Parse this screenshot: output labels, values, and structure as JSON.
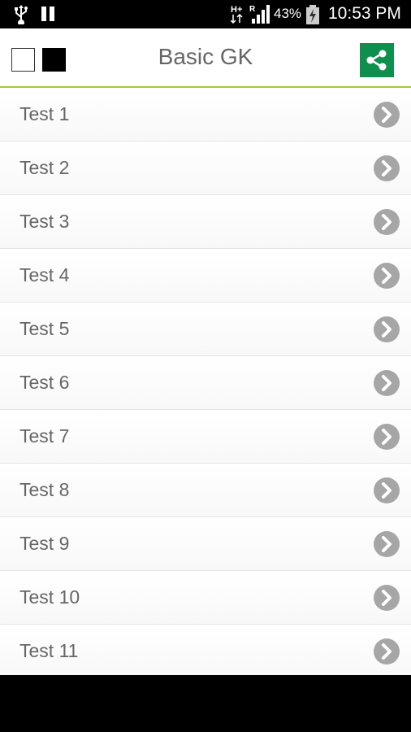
{
  "status_bar": {
    "network_label": "H+",
    "roaming_label": "R",
    "battery_percent": "43%",
    "time": "10:53 PM"
  },
  "app_bar": {
    "title": "Basic GK",
    "share_icon": "share-icon",
    "accent_color": "#0f8f4e",
    "divider_color": "#a4c639"
  },
  "tests": [
    {
      "label": "Test 1"
    },
    {
      "label": "Test 2"
    },
    {
      "label": "Test 3"
    },
    {
      "label": "Test 4"
    },
    {
      "label": "Test 5"
    },
    {
      "label": "Test 6"
    },
    {
      "label": "Test 7"
    },
    {
      "label": "Test 8"
    },
    {
      "label": "Test 9"
    },
    {
      "label": "Test 10"
    },
    {
      "label": "Test 11"
    }
  ]
}
